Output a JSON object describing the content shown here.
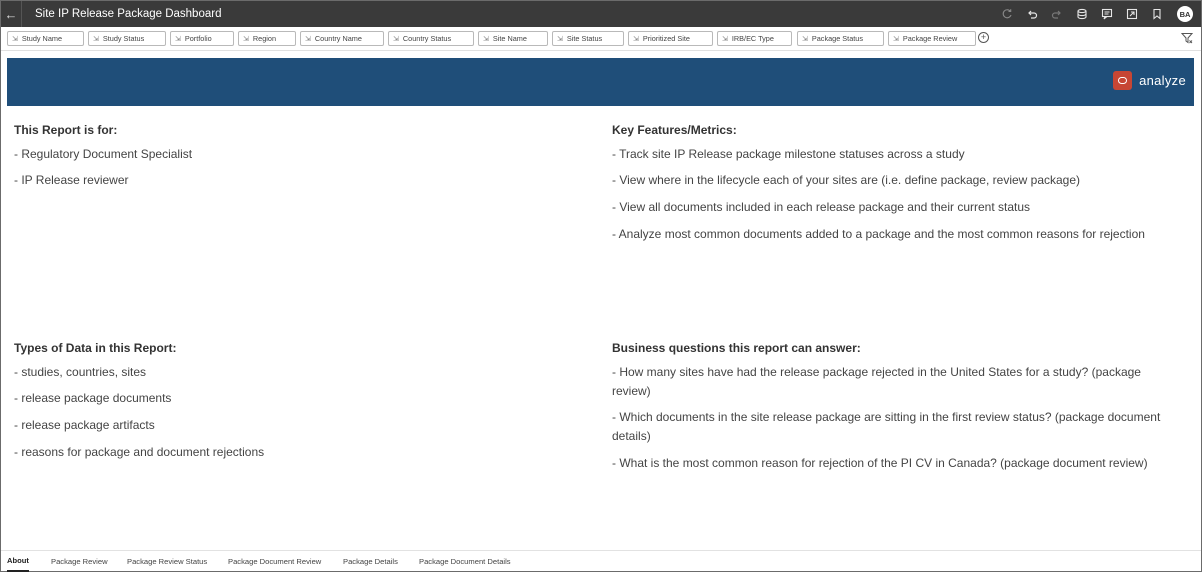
{
  "titlebar": {
    "back_icon": "arrow-left-icon",
    "title": "Site IP Release Package Dashboard",
    "tools": [
      {
        "name": "refresh-icon"
      },
      {
        "name": "undo-icon"
      },
      {
        "name": "redo-icon"
      },
      {
        "name": "data-icon"
      },
      {
        "name": "comment-icon"
      },
      {
        "name": "present-icon"
      },
      {
        "name": "bookmark-icon"
      }
    ],
    "avatar_initials": "BA"
  },
  "filters": [
    "Study Name",
    "Study Status",
    "Portfolio",
    "Region",
    "Country Name",
    "Country Status",
    "Site Name",
    "Site Status",
    "Prioritized Site",
    "IRB/EC Type",
    "Package Status",
    "Package Review"
  ],
  "filter_pin_glyph": "⇲",
  "add_filter_glyph": "+",
  "banner": {
    "brand_text": "analyze",
    "color": "#1f4e79",
    "logo_color": "#c74634"
  },
  "sections": {
    "audience": {
      "heading": "This Report is for:",
      "items": [
        "- Regulatory Document Specialist",
        "- IP Release reviewer"
      ]
    },
    "features": {
      "heading": "Key Features/Metrics:",
      "items": [
        "- Track site IP Release package milestone statuses across a study",
        "- View where in the lifecycle each of your sites are (i.e. define package, review package)",
        "- View all documents included in each release package and their current status",
        "- Analyze most common documents added to a package and the most common reasons for rejection"
      ]
    },
    "datatypes": {
      "heading": "Types of Data in this Report:",
      "items": [
        "- studies, countries, sites",
        "- release package documents",
        "- release package artifacts",
        "- reasons for package and document rejections"
      ]
    },
    "questions": {
      "heading": "Business questions this report can answer:",
      "items": [
        "- How many sites have had the release package rejected in the United States for a study? (package review)",
        "- Which documents in the site release package are sitting in the first review status? (package document details)",
        "- What is the most common reason for rejection of the PI CV in Canada? (package document review)"
      ]
    }
  },
  "tabs": [
    {
      "label": "About",
      "active": true
    },
    {
      "label": "Package Review",
      "active": false
    },
    {
      "label": "Package Review Status",
      "active": false
    },
    {
      "label": "Package Document Review",
      "active": false
    },
    {
      "label": "Package Details",
      "active": false
    },
    {
      "label": "Package Document Details",
      "active": false
    }
  ]
}
